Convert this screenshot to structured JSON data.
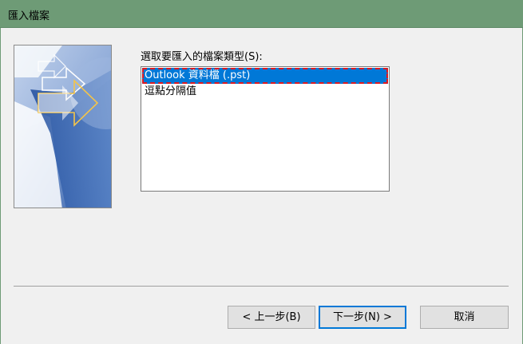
{
  "window": {
    "title": "匯入檔案"
  },
  "prompt_label": "選取要匯入的檔案類型(S):",
  "file_types": [
    {
      "label": "Outlook 資料檔 (.pst)",
      "selected": true
    },
    {
      "label": "逗點分隔值",
      "selected": false
    }
  ],
  "buttons": {
    "back": "< 上一步(B)",
    "next": "下一步(N) >",
    "cancel": "取消"
  },
  "colors": {
    "title_bar": "#6e9b76",
    "selection": "#0078d7",
    "highlight_outline": "#e0191f"
  }
}
